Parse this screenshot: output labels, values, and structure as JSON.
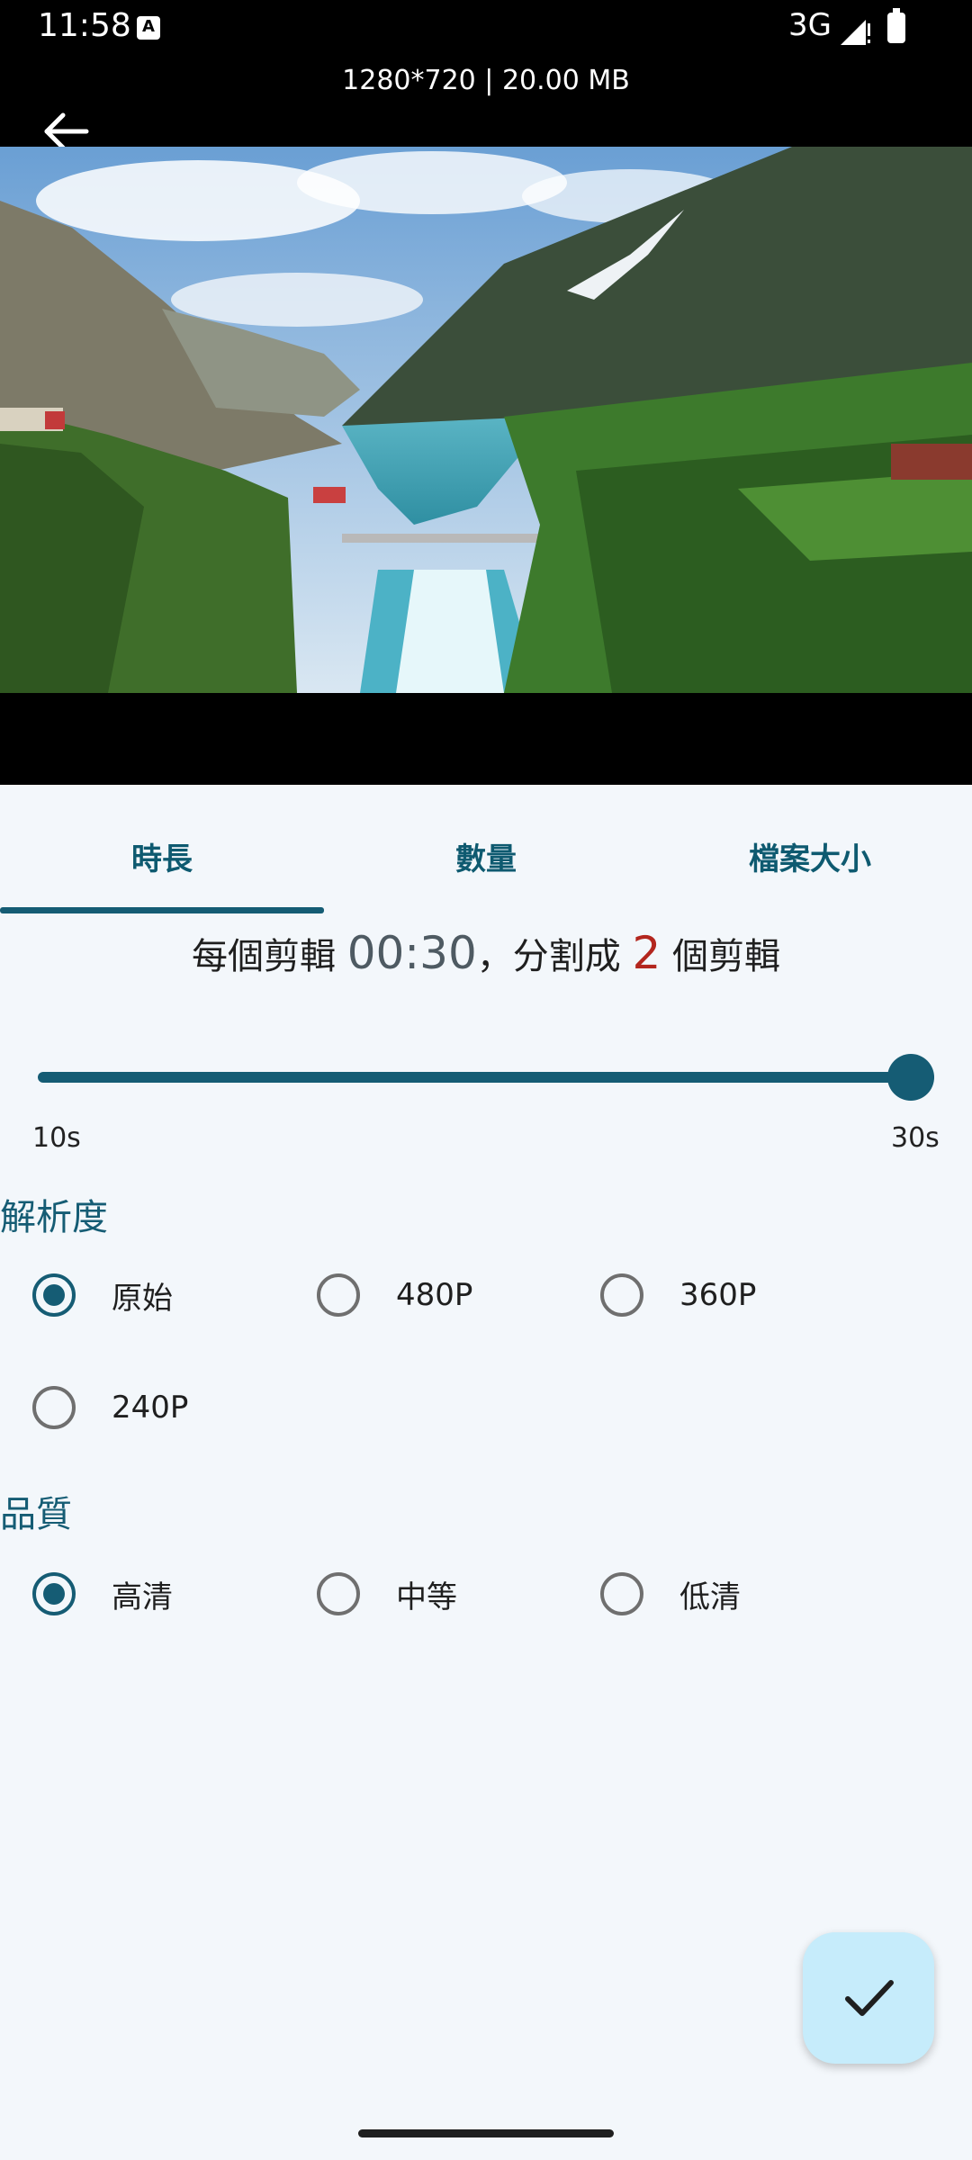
{
  "status_bar": {
    "time": "11:58",
    "network": "3G"
  },
  "header": {
    "file_info": "1280*720 | 20.00 MB"
  },
  "tabs": [
    {
      "label": "時長",
      "selected": true
    },
    {
      "label": "數量",
      "selected": false
    },
    {
      "label": "檔案大小",
      "selected": false
    }
  ],
  "summary": {
    "prefix": "每個剪輯",
    "duration": "00:30",
    "middle": "，分割成",
    "count": "2",
    "suffix": "個剪輯"
  },
  "slider": {
    "min_label": "10s",
    "max_label": "30s",
    "value_fraction": 1.0
  },
  "resolution": {
    "title": "解析度",
    "options": [
      {
        "label": "原始",
        "selected": true
      },
      {
        "label": "480P",
        "selected": false
      },
      {
        "label": "360P",
        "selected": false
      },
      {
        "label": "240P",
        "selected": false
      }
    ]
  },
  "quality": {
    "title": "品質",
    "options": [
      {
        "label": "高清",
        "selected": true
      },
      {
        "label": "中等",
        "selected": false
      },
      {
        "label": "低清",
        "selected": false
      }
    ]
  },
  "icons": {
    "back": "arrow-left-icon",
    "confirm": "check-icon"
  },
  "colors": {
    "accent": "#155c74",
    "count_highlight": "#b3261e",
    "fab_background": "#c6ecfb",
    "sheet_background": "#f3f7fb"
  }
}
